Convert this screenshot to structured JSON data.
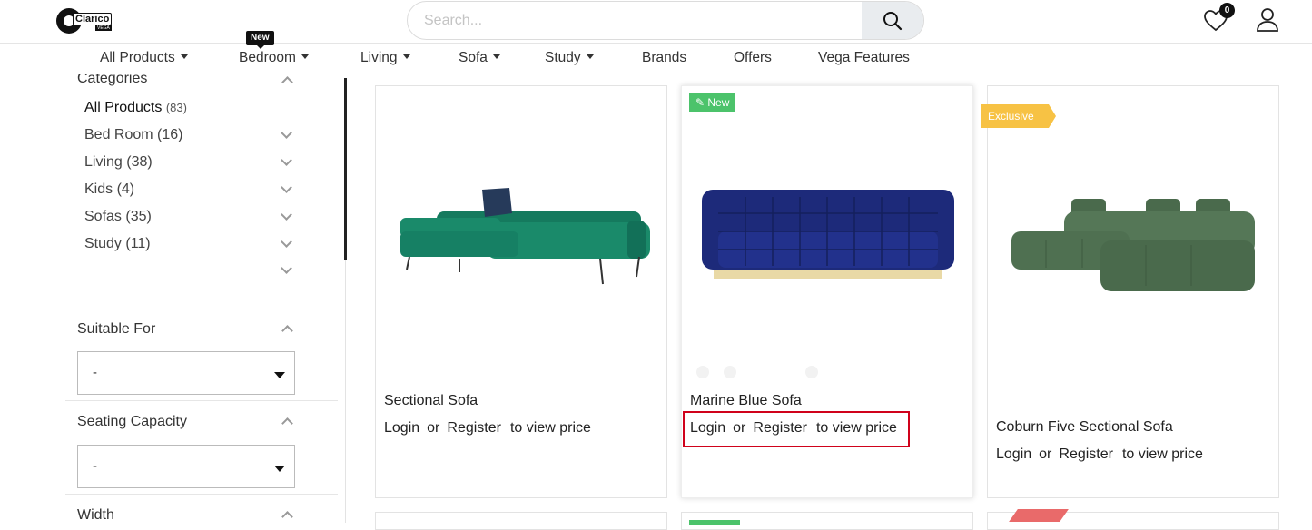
{
  "header": {
    "logo_text": "Clarico",
    "logo_sub": "VEGA",
    "search_placeholder": "Search...",
    "wishlist_count": "0"
  },
  "nav": {
    "items": [
      {
        "label": "All Products",
        "dropdown": true
      },
      {
        "label": "Bedroom",
        "dropdown": true,
        "tag": "New"
      },
      {
        "label": "Living",
        "dropdown": true
      },
      {
        "label": "Sofa",
        "dropdown": true
      },
      {
        "label": "Study",
        "dropdown": true
      },
      {
        "label": "Brands",
        "dropdown": false
      },
      {
        "label": "Offers",
        "dropdown": false
      },
      {
        "label": "Vega Features",
        "dropdown": false
      }
    ]
  },
  "sidebar": {
    "categories_title": "Categories",
    "categories": [
      {
        "label": "All Products",
        "count": "(83)"
      },
      {
        "label": "Bed Room (16)"
      },
      {
        "label": "Living (38)"
      },
      {
        "label": "Kids (4)"
      },
      {
        "label": "Sofas (35)"
      },
      {
        "label": "Study (11)"
      }
    ],
    "suitable_for": {
      "title": "Suitable For",
      "value": "-"
    },
    "seating_capacity": {
      "title": "Seating Capacity",
      "value": "-"
    },
    "width": {
      "title": "Width"
    }
  },
  "products": [
    {
      "name": "Sectional Sofa",
      "login": "Login",
      "or": "or",
      "register": "Register",
      "tail": "to view price",
      "color": "#1a8a6a"
    },
    {
      "name": "Marine Blue Sofa",
      "login": "Login",
      "or": "or",
      "register": "Register",
      "tail": "to view price",
      "tag": "New",
      "color": "#1d2a7a"
    },
    {
      "name": "Coburn Five Sectional Sofa",
      "login": "Login",
      "or": "or",
      "register": "Register",
      "tail": "to view price",
      "tag": "Exclusive",
      "color": "#4a6a4c"
    }
  ]
}
